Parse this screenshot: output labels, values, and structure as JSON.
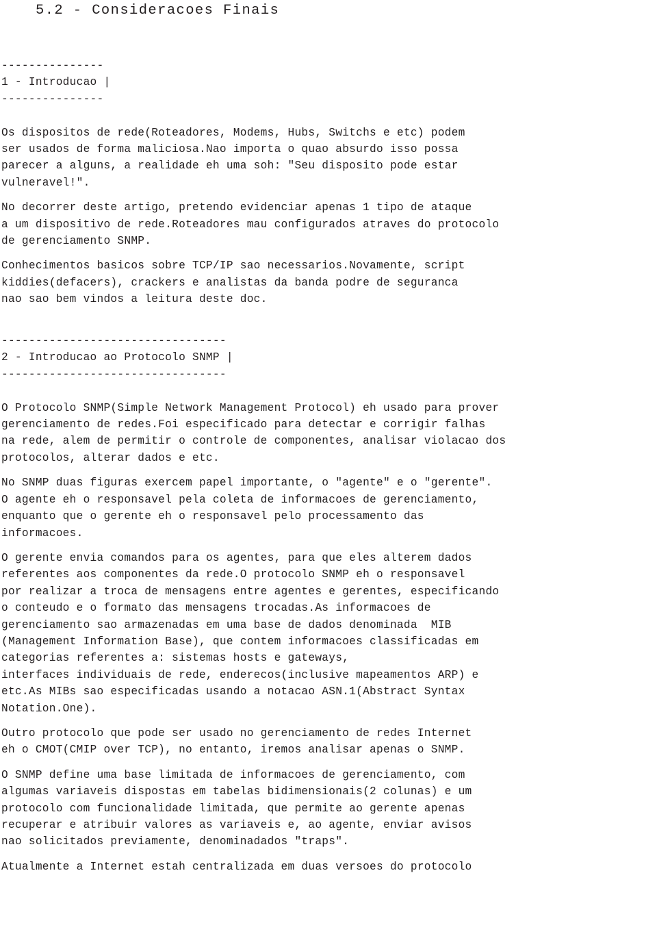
{
  "document": {
    "title": "5.2 - Consideracoes Finais",
    "sections": [
      {
        "id": "section-1",
        "rule_top": "---------------",
        "heading": "1 - Introducao |",
        "rule_bottom": "---------------",
        "paragraphs": [
          [
            "Os dispositos de rede(Roteadores, Modems, Hubs, Switchs e etc) podem",
            "ser usados de forma maliciosa.Nao importa o quao absurdo isso possa",
            "parecer a alguns, a realidade eh uma soh: \"Seu disposito pode estar",
            "vulneravel!\"."
          ],
          [
            "No decorrer deste artigo, pretendo evidenciar apenas 1 tipo de ataque",
            "a um dispositivo de rede.Roteadores mau configurados atraves do protocolo",
            "de gerenciamento SNMP."
          ],
          [
            "Conhecimentos basicos sobre TCP/IP sao necessarios.Novamente, script",
            "kiddies(defacers), crackers e analistas da banda podre de seguranca",
            "nao sao bem vindos a leitura deste doc."
          ]
        ]
      },
      {
        "id": "section-2",
        "rule_top": "---------------------------------",
        "heading": "2 - Introducao ao Protocolo SNMP |",
        "rule_bottom": "---------------------------------",
        "paragraphs": [
          [
            "O Protocolo SNMP(Simple Network Management Protocol) eh usado para prover",
            "gerenciamento de redes.Foi especificado para detectar e corrigir falhas",
            "na rede, alem de permitir o controle de componentes, analisar violacao dos",
            "protocolos, alterar dados e etc."
          ],
          [
            "No SNMP duas figuras exercem papel importante, o \"agente\" e o \"gerente\".",
            "O agente eh o responsavel pela coleta de informacoes de gerenciamento,",
            "enquanto que o gerente eh o responsavel pelo processamento das",
            "informacoes."
          ],
          [
            "O gerente envia comandos para os agentes, para que eles alterem dados",
            "referentes aos componentes da rede.O protocolo SNMP eh o responsavel",
            "por realizar a troca de mensagens entre agentes e gerentes, especificando",
            "o conteudo e o formato das mensagens trocadas.As informacoes de",
            "gerenciamento sao armazenadas em uma base de dados denominada  MIB",
            "(Management Information Base), que contem informacoes classificadas em",
            "categorias referentes a: sistemas hosts e gateways,",
            "interfaces individuais de rede, enderecos(inclusive mapeamentos ARP) e",
            "etc.As MIBs sao especificadas usando a notacao ASN.1(Abstract Syntax",
            "Notation.One)."
          ],
          [
            "Outro protocolo que pode ser usado no gerenciamento de redes Internet",
            "eh o CMOT(CMIP over TCP), no entanto, iremos analisar apenas o SNMP."
          ],
          [
            "O SNMP define uma base limitada de informacoes de gerenciamento, com",
            "algumas variaveis dispostas em tabelas bidimensionais(2 colunas) e um",
            "protocolo com funcionalidade limitada, que permite ao gerente apenas",
            "recuperar e atribuir valores as variaveis e, ao agente, enviar avisos",
            "nao solicitados previamente, denominadados \"traps\"."
          ],
          [
            "Atualmente a Internet estah centralizada em duas versoes do protocolo"
          ]
        ]
      }
    ]
  }
}
